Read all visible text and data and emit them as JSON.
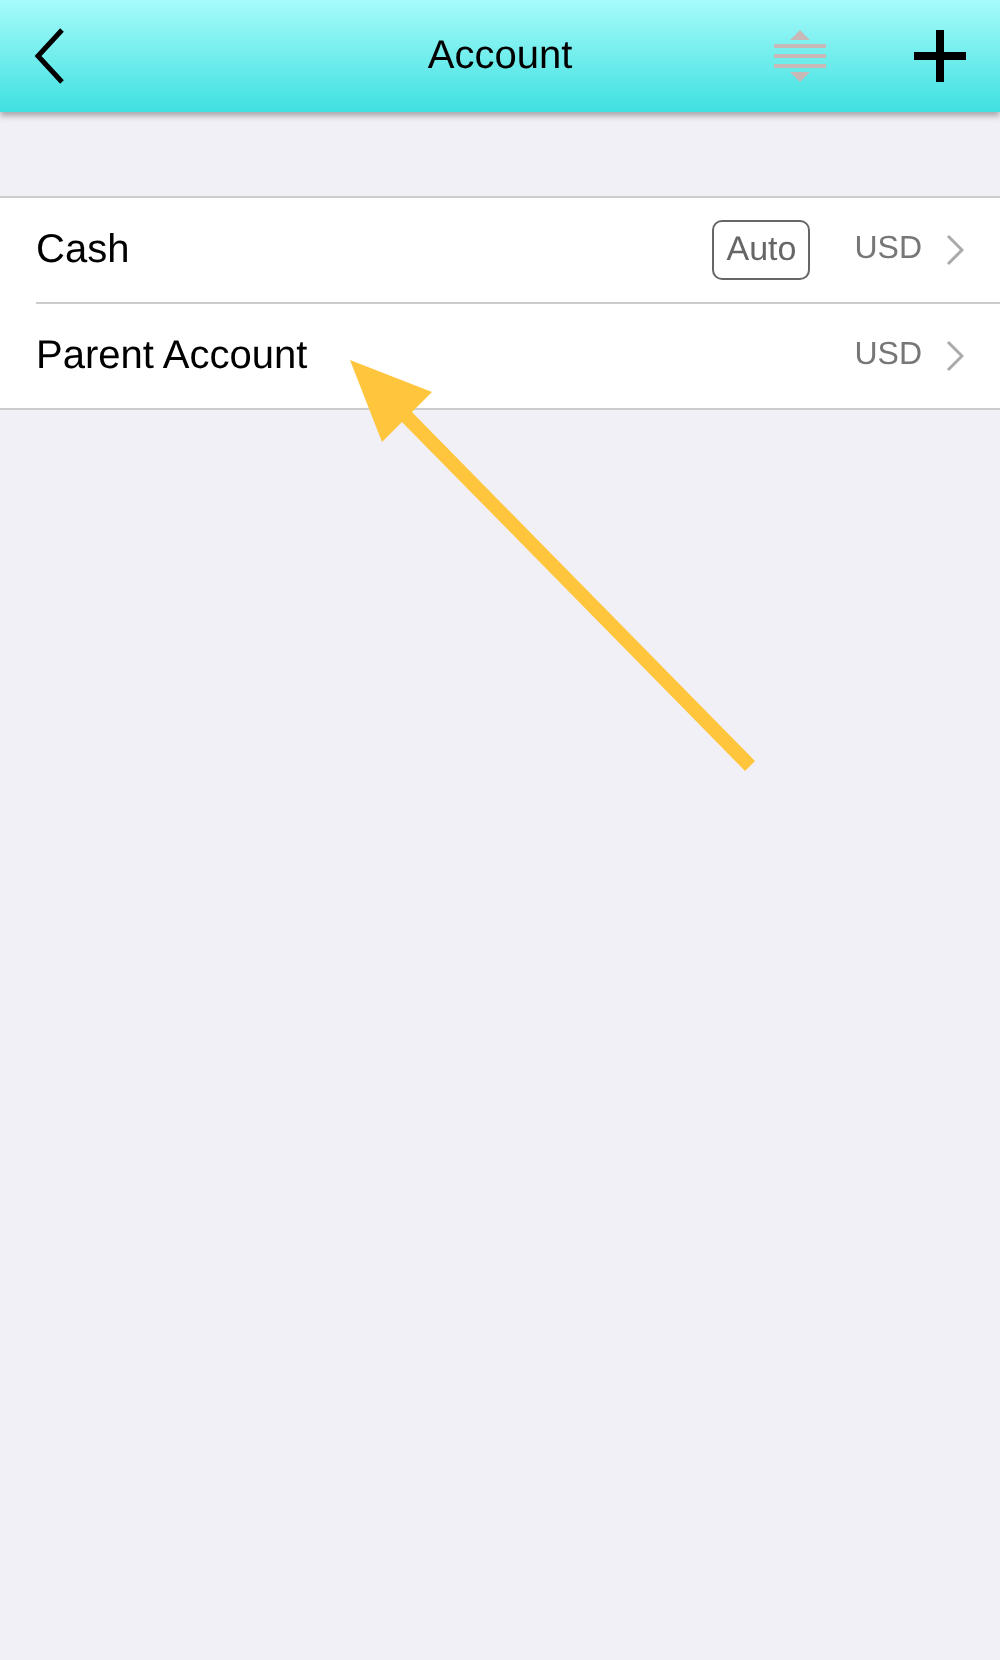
{
  "header": {
    "title": "Account"
  },
  "accounts": [
    {
      "name": "Cash",
      "badge": "Auto",
      "currency": "USD"
    },
    {
      "name": "Parent Account",
      "currency": "USD"
    }
  ]
}
